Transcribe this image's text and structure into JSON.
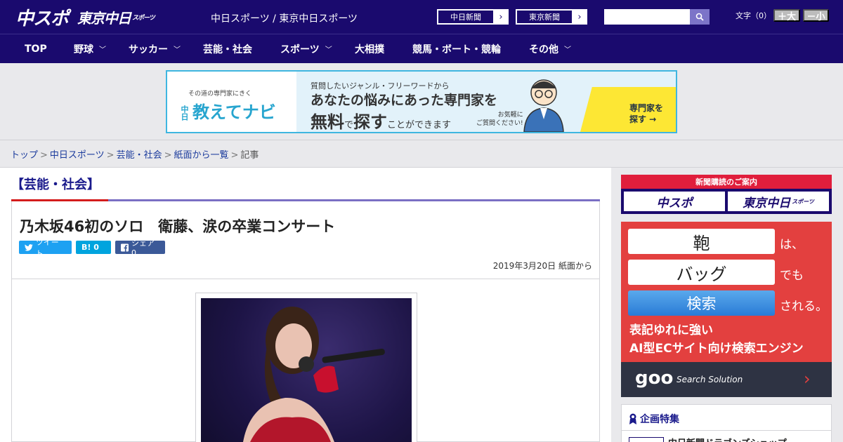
{
  "header": {
    "logo_chuspo": "中スポ",
    "logo_tokyo": "東京中日",
    "logo_tokyo_small": "スポーツ",
    "site_links": "中日スポーツ / 東京中日スポーツ",
    "btn_chunichi": "中日新聞",
    "btn_tokyo": "東京新聞",
    "search_placeholder": "",
    "font_size_label": "文字（0）",
    "font_bigger": "＋大",
    "font_smaller": "－小"
  },
  "nav": {
    "items": [
      {
        "label": "TOP",
        "dropdown": false
      },
      {
        "label": "野球",
        "dropdown": true
      },
      {
        "label": "サッカー",
        "dropdown": true
      },
      {
        "label": "芸能・社会",
        "dropdown": false
      },
      {
        "label": "スポーツ",
        "dropdown": true
      },
      {
        "label": "大相撲",
        "dropdown": false
      },
      {
        "label": "競馬・ボート・競輪",
        "dropdown": false
      },
      {
        "label": "その他",
        "dropdown": true
      }
    ]
  },
  "banner": {
    "sub": "その道の専門家にきく",
    "brand_tate": "中日",
    "brand": "教えてナビ",
    "line1": "質問したいジャンル・フリーワードから",
    "line2": "あなたの悩みにあった専門家を",
    "line3a": "無料",
    "line3b": "で",
    "line3c": "探す",
    "line3d": "ことができます",
    "note1": "お気軽に",
    "note2": "ご質問ください!",
    "cta1": "専門家を",
    "cta2": "探す →",
    "accent": "#3fb6e0"
  },
  "breadcrumb": {
    "items": [
      "トップ",
      "中日スポーツ",
      "芸能・社会",
      "紙面から一覧"
    ],
    "current": "記事",
    "separator": ">"
  },
  "article": {
    "category": "【芸能・社会】",
    "headline": "乃木坂46初のソロ　衛藤、涙の卒業コンサート",
    "share_tweet": "ツイート",
    "share_hatena": "B! 0",
    "share_facebook": "シェア 0",
    "date": "2019年3月20日 紙面から"
  },
  "sidebar": {
    "subscribe_title": "新聞購読のご案内",
    "sub_logo1": "中スポ",
    "sub_logo2": "東京中日",
    "sub_logo2_small": "スポーツ",
    "ad_word1": "鞄",
    "ad_suffix1": "は、",
    "ad_word2": "バッグ",
    "ad_suffix2": "でも",
    "ad_search": "検索",
    "ad_suffix3": "される。",
    "ad_tag1": "表記ゆれに強い",
    "ad_tag2": "AI型ECサイト向け検索エンジン",
    "ad_brand": "goo",
    "ad_solution": "Search Solution",
    "feature_title": "企画特集",
    "feature_item": "中日新聞ドラゴンズショップ"
  },
  "colors": {
    "header_bg": "#1a0a6e",
    "accent_red": "#d41c1c",
    "ad_red": "#e3403f"
  }
}
